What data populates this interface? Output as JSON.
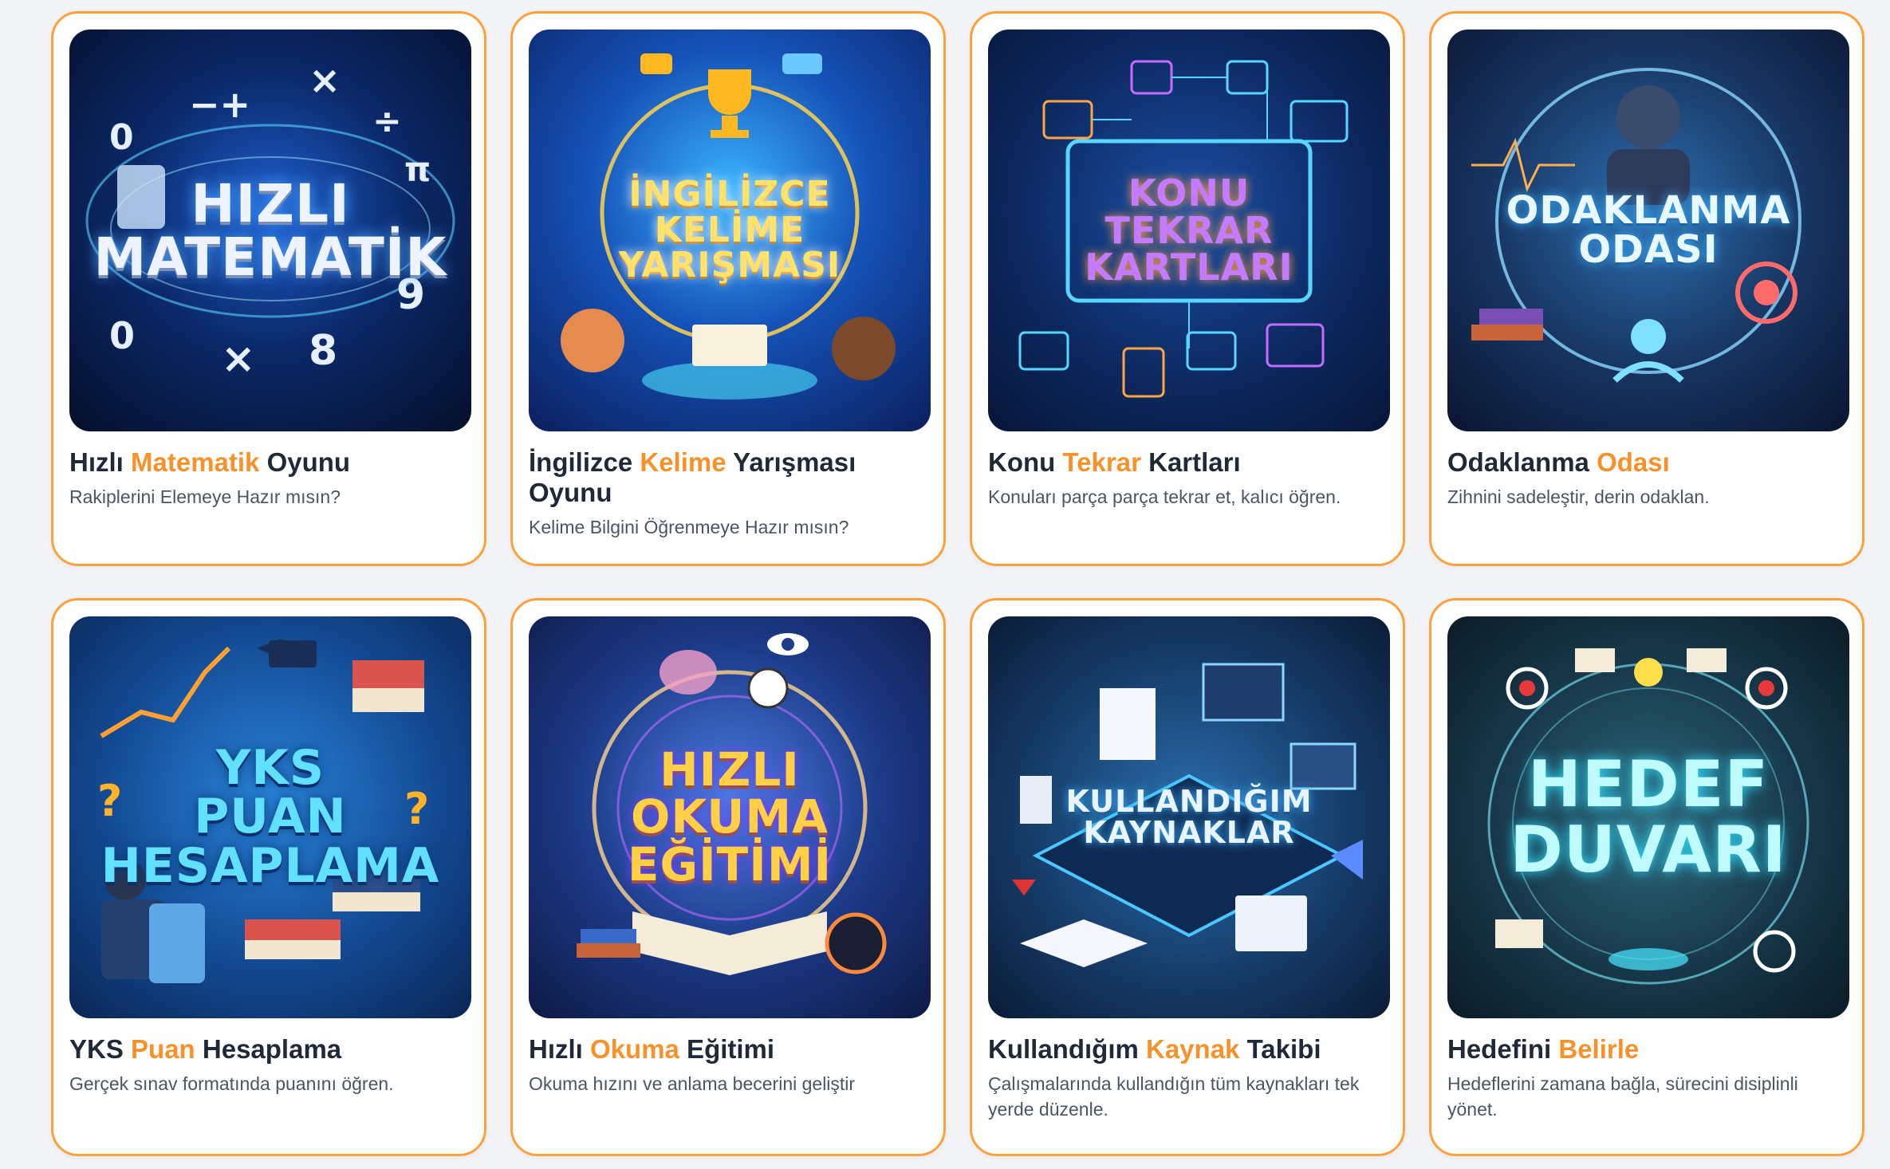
{
  "cards": [
    {
      "thumb_title": "HIZLI\nMATEMATİK",
      "icon": "math-symbols-icon",
      "title_pre": "Hızlı ",
      "title_accent": "Matematik",
      "title_post": " Oyunu",
      "subtitle": "Rakiplerini Elemeye Hazır mısın?"
    },
    {
      "thumb_title": "İNGİLİZCE\nKELİME\nYARIŞMASI",
      "icon": "trophy-icon",
      "title_pre": "İngilizce ",
      "title_accent": "Kelime",
      "title_post": " Yarışması Oyunu",
      "subtitle": "Kelime Bilgini Öğrenmeye Hazır mısın?"
    },
    {
      "thumb_title": "KONU\nTEKRAR\nKARTLARI",
      "icon": "flashcards-icon",
      "title_pre": "Konu ",
      "title_accent": "Tekrar",
      "title_post": " Kartları",
      "subtitle": "Konuları parça parça tekrar et, kalıcı öğren."
    },
    {
      "thumb_title": "ODAKLANMA\nODASI",
      "icon": "meditation-icon",
      "title_pre": "Odaklanma ",
      "title_accent": "Odası",
      "title_post": "",
      "subtitle": "Zihnini sadeleştir, derin odaklan."
    },
    {
      "thumb_title": "YKS\nPUAN\nHESAPLAMA",
      "icon": "calculator-icon",
      "title_pre": "YKS ",
      "title_accent": "Puan",
      "title_post": " Hesaplama",
      "subtitle": "Gerçek sınav formatında puanını öğren."
    },
    {
      "thumb_title": "HIZLI\nOKUMA\nEĞİTİMİ",
      "icon": "open-book-icon",
      "title_pre": "Hızlı ",
      "title_accent": "Okuma",
      "title_post": " Eğitimi",
      "subtitle": "Okuma hızını ve anlama becerini geliştir"
    },
    {
      "thumb_title": "KULLANDIĞIM\nKAYNAKLAR",
      "icon": "resources-icon",
      "title_pre": "Kullandığım ",
      "title_accent": "Kaynak",
      "title_post": " Takibi",
      "subtitle": "Çalışmalarında kullandığın tüm kaynakları tek yerde düzenle."
    },
    {
      "thumb_title": "HEDEF\nDUVARI",
      "icon": "target-icon",
      "title_pre": "Hedefini ",
      "title_accent": "Belirle",
      "title_post": "",
      "subtitle": "Hedeflerini zamana bağla, sürecini disiplinli yönet."
    }
  ],
  "colors": {
    "accent": "#f7922a",
    "card_border": "#f8a23c",
    "title": "#1f2937",
    "subtitle": "#4b5563"
  }
}
